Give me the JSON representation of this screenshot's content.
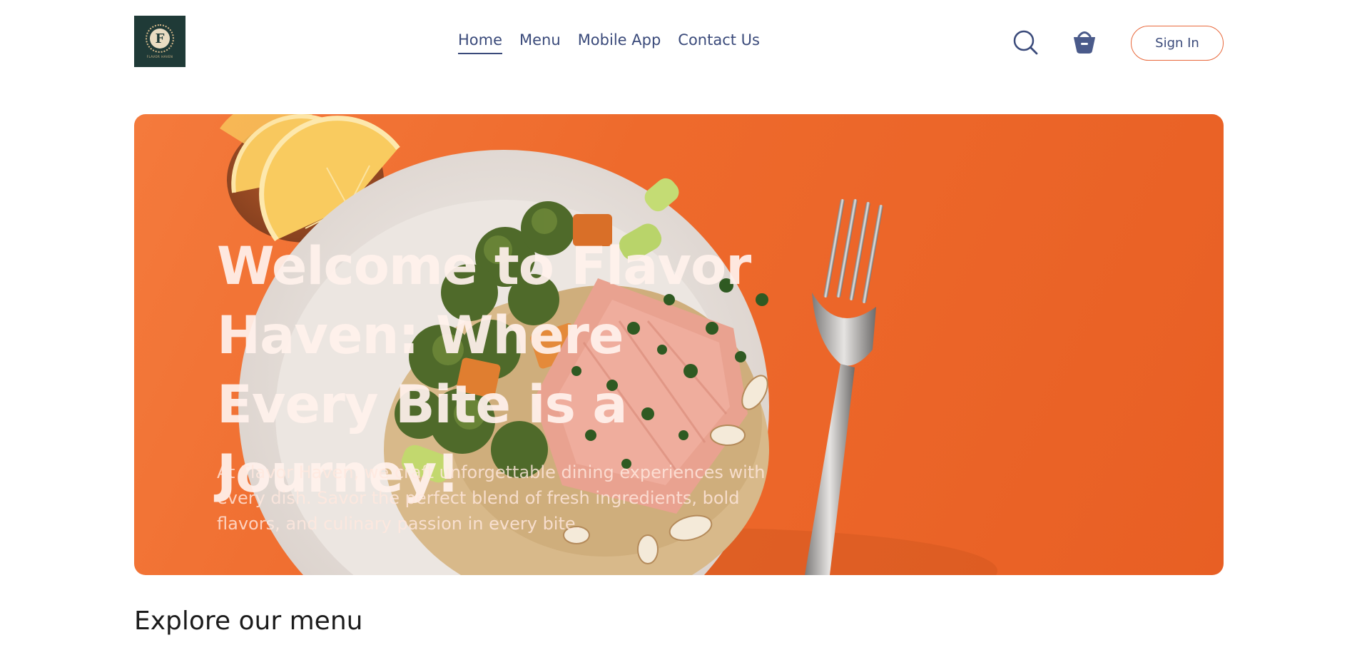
{
  "navbar": {
    "logo_text": "FLAVOR HAVEN",
    "logo_mark": "F",
    "links": [
      {
        "label": "Home",
        "active": true
      },
      {
        "label": "Menu",
        "active": false
      },
      {
        "label": "Mobile App",
        "active": false
      },
      {
        "label": "Contact Us",
        "active": false
      }
    ],
    "search_icon": "search-icon",
    "cart_icon": "basket-icon",
    "signin_label": "Sign In"
  },
  "hero": {
    "title": "Welcome to Flavor Haven: Where Every Bite is a Journey!",
    "description": "At Flavor Haven, we craft unforgettable dining experiences with every dish. Savor the perfect blend of fresh ingredients, bold flavors, and culinary passion in every bite."
  },
  "section": {
    "title": "Explore our menu"
  },
  "colors": {
    "nav_text": "#3a4a7a",
    "accent": "#e8683b",
    "hero_bg": "#ee6a2c",
    "logo_bg": "#1f3a37"
  }
}
